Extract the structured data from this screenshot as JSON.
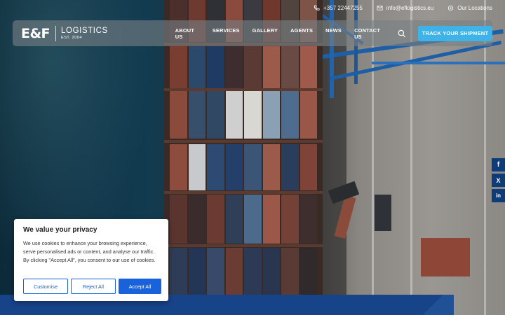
{
  "topbar": {
    "phone": "+357 22447255",
    "email": "info@eflogistics.eu",
    "locations": "Our Locations"
  },
  "logo": {
    "mark": "E&F",
    "name": "LOGISTICS",
    "est": "EST. 2004"
  },
  "nav": {
    "items": [
      {
        "label": "ABOUT US"
      },
      {
        "label": "SERVICES"
      },
      {
        "label": "GALLERY"
      },
      {
        "label": "AGENTS"
      },
      {
        "label": "NEWS"
      },
      {
        "label": "CONTACT US"
      }
    ],
    "cta_label": "TRACK YOUR SHIPMENT"
  },
  "social": {
    "facebook": "f",
    "x": "X",
    "linkedin": "in"
  },
  "cookie": {
    "title": "We value your privacy",
    "body": "We use cookies to enhance your browsing experience, serve personalised ads or content, and analyse our traffic. By clicking \"Accept All\", you consent to our use of cookies.",
    "customise": "Customise",
    "reject": "Reject All",
    "accept": "Accept All"
  },
  "colors": {
    "cta": "#3db3ea",
    "social_bg": "#0d3c78",
    "banner": "#174389",
    "cookie_primary": "#1863dc"
  },
  "icons": [
    "phone-icon",
    "email-icon",
    "location-icon",
    "search-icon",
    "facebook-icon",
    "x-icon",
    "linkedin-icon"
  ]
}
